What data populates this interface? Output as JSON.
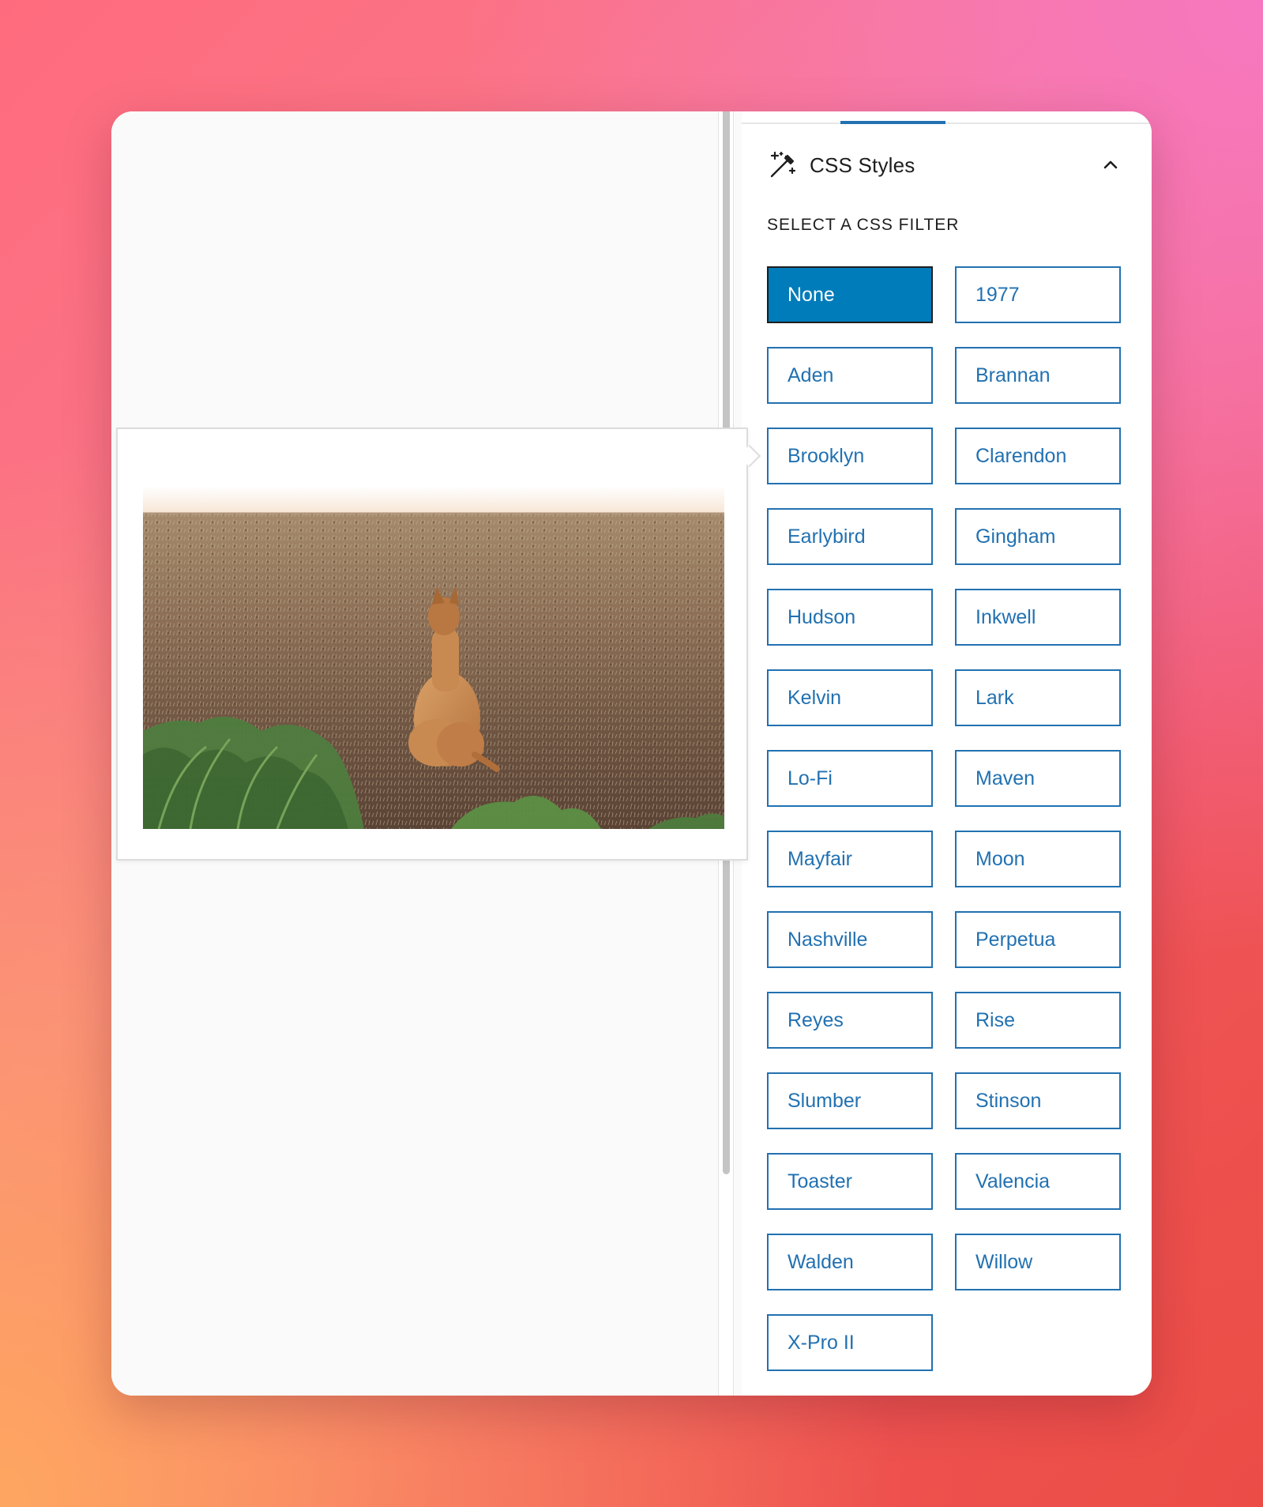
{
  "panel": {
    "title": "CSS Styles",
    "icon": "magic-wand-icon",
    "toggle_icon": "chevron-up-icon"
  },
  "filter_section": {
    "label": "SELECT A CSS FILTER",
    "selected": "None",
    "options": [
      "None",
      "1977",
      "Aden",
      "Brannan",
      "Brooklyn",
      "Clarendon",
      "Earlybird",
      "Gingham",
      "Hudson",
      "Inkwell",
      "Kelvin",
      "Lark",
      "Lo-Fi",
      "Maven",
      "Mayfair",
      "Moon",
      "Nashville",
      "Perpetua",
      "Reyes",
      "Rise",
      "Slumber",
      "Stinson",
      "Toaster",
      "Valencia",
      "Walden",
      "Willow",
      "X-Pro II"
    ]
  },
  "colors": {
    "accent": "#2271b1",
    "selected_bg": "#007cba",
    "text": "#1e1e1e"
  }
}
